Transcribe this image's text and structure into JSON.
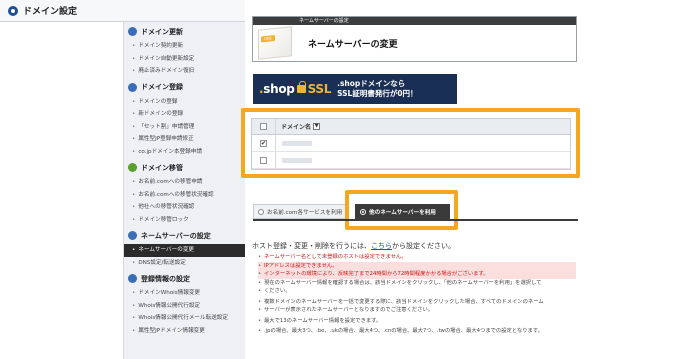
{
  "sidebar": {
    "title": "ドメイン設定",
    "sections": [
      {
        "title": "ドメイン更新",
        "color": "#3b6cb7",
        "items": [
          "ドメイン契約更新",
          "ドメイン自動更新設定",
          "廃止済みドメイン復旧"
        ]
      },
      {
        "title": "ドメイン登録",
        "color": "#3b6cb7",
        "items": [
          "ドメインの登録",
          "新ドメインの登録",
          "「セット割」申請管理",
          "属性型JP登録申請修正",
          "co.jpドメイン本登録申請"
        ]
      },
      {
        "title": "ドメイン移管",
        "color": "#5aa02c",
        "items": [
          "お名前.comへの移管申請",
          "お名前.comへの移管状況確認",
          "他社への移管状況確認",
          "ドメイン移管ロック"
        ]
      },
      {
        "title": "ネームサーバーの設定",
        "color": "#3b6cb7",
        "items": [
          "ネームサーバーの変更",
          "DNS設定/転送設定"
        ],
        "active_index": 0
      },
      {
        "title": "登録情報の設定",
        "color": "#3b6cb7",
        "items": [
          "ドメインWhois情報変更",
          "Whois情報公開代行設定",
          "Whois情報公開代行メール転送設定",
          "属性型JPドメイン情報変更"
        ]
      }
    ]
  },
  "header": {
    "bar_text": "ネームサーバーの設定",
    "title": "ネームサーバーの変更",
    "icon_tag": "DNS"
  },
  "banner": {
    "logo_dot": ".",
    "logo_shop": "shop",
    "logo_ssl": "SSL",
    "line1": ".shopドメインなら",
    "line2": "SSL証明書発行が0円！"
  },
  "domain_table": {
    "header": "ドメイン名",
    "sort_glyph": "▼",
    "rows": [
      {
        "checked": true
      },
      {
        "checked": false
      }
    ]
  },
  "tabs": {
    "inactive": "お名前.com各サービスを利用",
    "active": "他のネームサーバーを利用"
  },
  "intro": {
    "before": "ホスト登録・変更・削除を行うには、",
    "link": "こちら",
    "after": "から設定ください。"
  },
  "notes": [
    {
      "text": "ネームサーバー名として未登録のホストは設定できません。",
      "style": "warn"
    },
    {
      "text": "IPアドレスは設定できません。",
      "style": "warn hl"
    },
    {
      "text": "インターネットの環境により、反映完了まで24時間から72時間程度かかる場合がございます。",
      "style": "warn hl"
    },
    {
      "text": "現在のネームサーバー情報を確認する場合は、該当ドメインをクリックし、「他のネームサーバーを利用」を選択して",
      "style": ""
    },
    {
      "text": "ください。",
      "style": ""
    },
    {
      "text": "複数ドメインのネームサーバーを一括で変更する際に、該当ドメインをクリックした場合、すべてのドメインのネーム",
      "style": "gap"
    },
    {
      "text": "サーバーが表示されたネームサーバーとなりますのでご注意ください。",
      "style": ""
    },
    {
      "text": "最大で13のネームサーバー情報を設定できます。",
      "style": "gap"
    },
    {
      "text": ".jpの場合、最大3つ、.be、.ukの場合、最大4つ、.cnの場合、最大7つ、.twの場合、最大4つまでの設定となります。",
      "style": "gap"
    }
  ]
}
